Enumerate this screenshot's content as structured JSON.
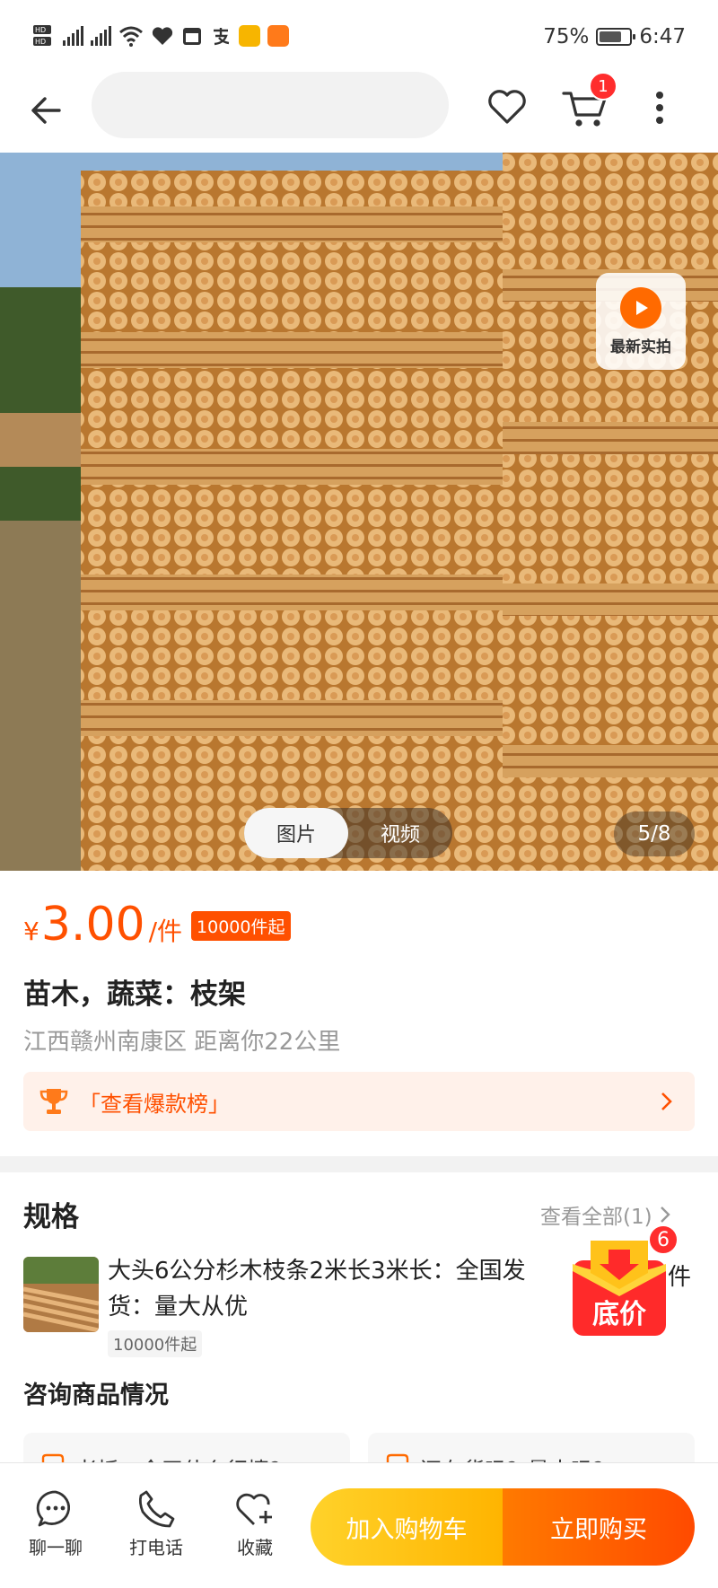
{
  "status_bar": {
    "battery_percent": "75%",
    "battery_level": 0.75,
    "time": "6:47"
  },
  "nav": {
    "search_placeholder": "",
    "cart_count": "1"
  },
  "gallery": {
    "live_label": "最新实拍",
    "tabs": [
      "图片",
      "视频"
    ],
    "active_tab": 0,
    "counter": "5/8"
  },
  "product": {
    "currency": "¥",
    "price": "3.00",
    "unit": "/件",
    "moq_tag": "10000件起",
    "title": "苗木，蔬菜：枝架",
    "location": "江西赣州南康区 距离你22公里",
    "rank_link": "「查看爆款榜」"
  },
  "specs": {
    "title": "规格",
    "view_all": "查看全部(1)",
    "item_name": "大头6公分杉木枝条2米长3米长：全国发货：量大从优",
    "item_suffix": "件",
    "item_moq": "10000件起",
    "promo_label": "底价",
    "promo_count": "6"
  },
  "consult": {
    "title": "咨询商品情况",
    "questions": [
      "老板，今天什么行情？",
      "还有货吗？量大吗？"
    ]
  },
  "bottom_bar": {
    "chat": "聊一聊",
    "call": "打电话",
    "favorite": "收藏",
    "add_to_cart": "加入购物车",
    "buy_now": "立即购买"
  },
  "colors": {
    "accent": "#ff5000",
    "cart_button": "#ffc21a",
    "buy_button": "#ff5a00",
    "badge": "#ff2d2d"
  }
}
